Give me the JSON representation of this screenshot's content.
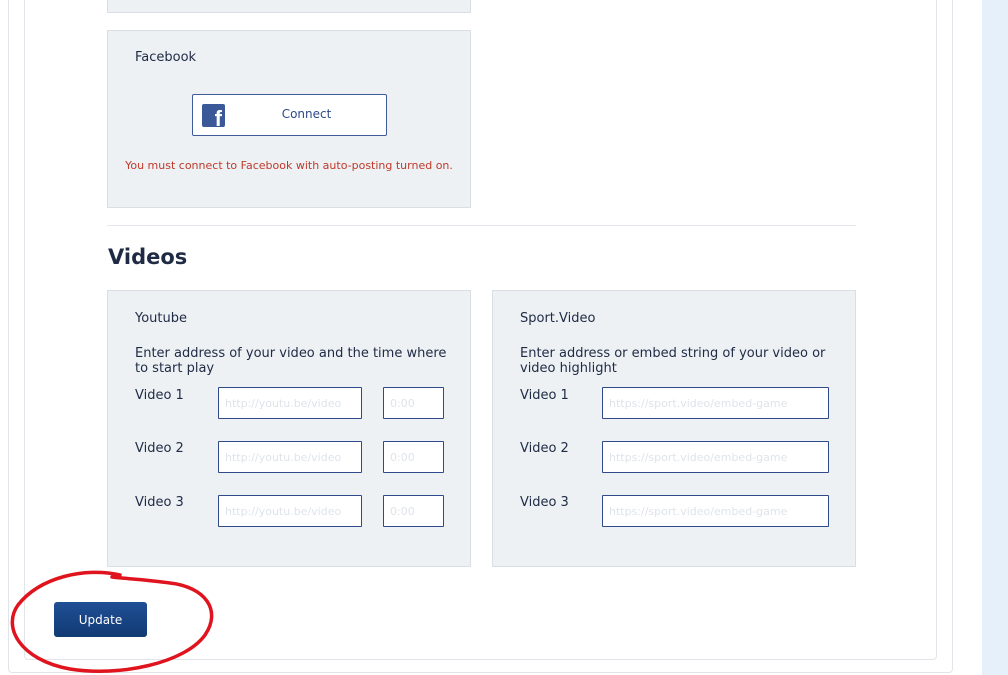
{
  "facebook": {
    "title": "Facebook",
    "connect_label": "Connect",
    "icon": "facebook-icon",
    "warning": "You must connect to Facebook with auto-posting turned on."
  },
  "videos": {
    "title": "Videos",
    "youtube": {
      "title": "Youtube",
      "instructions": "Enter address of your video and the time where to start play",
      "rows": [
        {
          "label": "Video 1",
          "url_placeholder": "http://youtu.be/video",
          "time_placeholder": "0:00"
        },
        {
          "label": "Video 2",
          "url_placeholder": "http://youtu.be/video",
          "time_placeholder": "0:00"
        },
        {
          "label": "Video 3",
          "url_placeholder": "http://youtu.be/video",
          "time_placeholder": "0:00"
        }
      ]
    },
    "sportvideo": {
      "title": "Sport.Video",
      "instructions": "Enter address or embed string of your video or video highlight",
      "rows": [
        {
          "label": "Video 1",
          "url_placeholder": "https://sport.video/embed-game"
        },
        {
          "label": "Video 2",
          "url_placeholder": "https://sport.video/embed-game"
        },
        {
          "label": "Video 3",
          "url_placeholder": "https://sport.video/embed-game"
        }
      ]
    }
  },
  "update_label": "Update",
  "colors": {
    "accent": "#1a4686",
    "facebook": "#3b5998",
    "warning": "#c0392b",
    "panel_bg": "#edf1f4",
    "annotation": "#e0141e"
  }
}
